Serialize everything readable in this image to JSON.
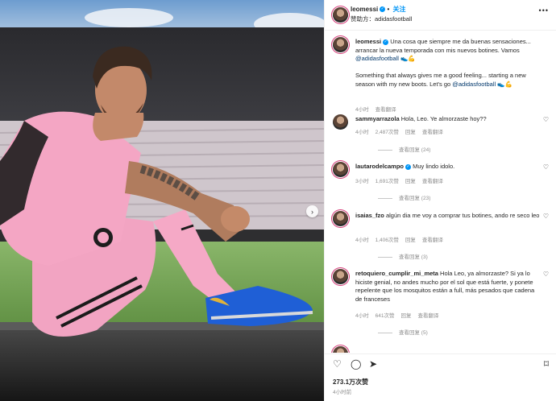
{
  "header": {
    "username": "leomessi",
    "follow_label": "关注",
    "separator": "•",
    "sponsor_prefix": "赞助方：",
    "sponsor": "adidasfootball",
    "more_icon": "more-icon"
  },
  "caption": {
    "username": "leomessi",
    "text_es": "Una cosa que siempre me da buenas sensaciones... arrancar la nueva temporada con mis nuevos botines. Vamos",
    "mention_es": "@adidasfootball",
    "emoji_es": "👟💪",
    "text_en": "Something that always gives me a good feeling... starting a new season with my new boots. Let's go",
    "mention_en": "@adidasfootball",
    "emoji_en": "👟💪",
    "time": "4小时",
    "translate": "查看翻译"
  },
  "comments": [
    {
      "username": "sammyarrazola",
      "text": "Hola, Leo. Ye almorzaste hoy??",
      "time": "4小时",
      "likes": "2,487次赞",
      "reply": "回复",
      "translate": "查看翻译",
      "view_replies": "查看回复 (24)"
    },
    {
      "username": "lautarodelcampo",
      "text": "Muy lindo idolo.",
      "time": "3小时",
      "likes": "1,691次赞",
      "reply": "回复",
      "translate": "查看翻译",
      "view_replies": "查看回复 (23)"
    },
    {
      "username": "isaias_fzo",
      "text": "algún dia me voy a comprar tus botines, ando re seco leo",
      "time": "4小时",
      "likes": "1,406次赞",
      "reply": "回复",
      "translate": "查看翻译",
      "view_replies": "查看回复 (3)"
    },
    {
      "username": "retoquiero_cumplir_mi_meta",
      "text": "Hola Leo, ya almorzaste? Si ya lo hiciste genial, no andes mucho por el sol que está fuerte, y ponete repelente que los mosquitos están a full, más pesados que cadena de franceses",
      "time": "4小时",
      "likes": "641次赞",
      "reply": "回复",
      "translate": "查看翻译",
      "view_replies": "查看回复 (5)"
    }
  ],
  "actions": {
    "like_icon": "heart-icon",
    "comment_icon": "comment-icon",
    "share_icon": "share-icon",
    "save_icon": "bookmark-icon"
  },
  "likes": "273.1万次赞",
  "post_time": "4小时前",
  "colors": {
    "jersey_pink": "#f4a6c4",
    "boot_blue": "#1f5fd6",
    "verified_blue": "#0095f6",
    "link_blue": "#00376b"
  }
}
